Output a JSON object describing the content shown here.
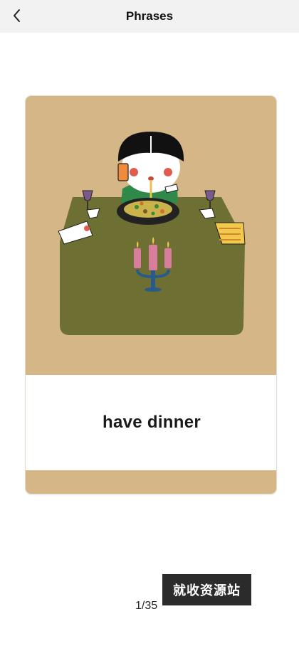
{
  "header": {
    "title": "Phrases",
    "back_icon": "chevron-left-icon"
  },
  "card": {
    "illustration": "girl-eating-dinner-at-table",
    "word": "have dinner",
    "colors": {
      "card_background": "#d5b686",
      "table": "#6e6f33",
      "panel": "#ffffff"
    }
  },
  "pager": {
    "counter": "1/35"
  },
  "watermark": {
    "text": "就收资源站"
  }
}
